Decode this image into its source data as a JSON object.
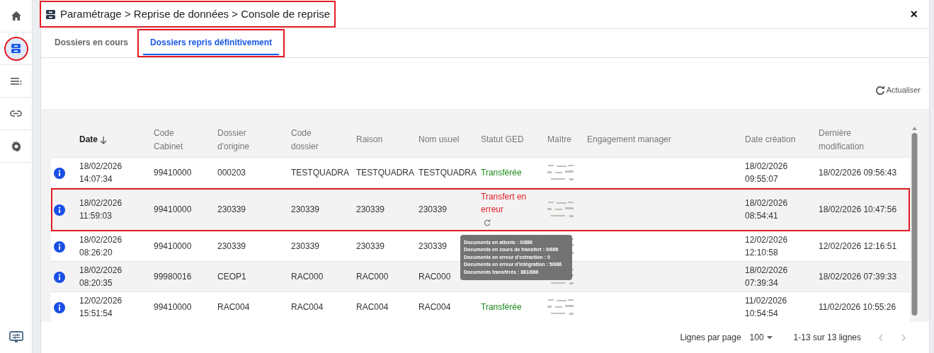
{
  "sidebar": {
    "items": [
      {
        "kind": "home",
        "selected": false,
        "highlighted": false
      },
      {
        "kind": "inbox",
        "selected": true,
        "highlighted": true
      },
      {
        "kind": "list",
        "selected": false,
        "highlighted": false
      },
      {
        "kind": "link",
        "selected": false,
        "highlighted": false
      },
      {
        "kind": "settings",
        "selected": false,
        "highlighted": false
      }
    ],
    "bottom_item": {
      "kind": "monitor",
      "selected": false
    }
  },
  "header": {
    "breadcrumb": "Paramétrage > Reprise de données > Console de reprise",
    "highlighted": true,
    "close": "×"
  },
  "tabs": [
    {
      "label": "Dossiers en cours",
      "selected": false,
      "highlighted": false
    },
    {
      "label": "Dossiers repris définitivement",
      "selected": true,
      "highlighted": true
    }
  ],
  "refresh": {
    "label": "Actualiser"
  },
  "table": {
    "columns": [
      {
        "label": "Date",
        "sorted": true
      },
      {
        "label": "Code Cabinet",
        "sorted": false
      },
      {
        "label": "Dossier d'origine",
        "sorted": false
      },
      {
        "label": "Code dossier",
        "sorted": false
      },
      {
        "label": "Raison",
        "sorted": false
      },
      {
        "label": "Nom usuel",
        "sorted": false
      },
      {
        "label": "Statut GED",
        "sorted": false
      },
      {
        "label": "Maître",
        "sorted": false
      },
      {
        "label": "Engagement manager",
        "sorted": false
      },
      {
        "label": "Date création",
        "sorted": false
      },
      {
        "label": "Dernière modification",
        "sorted": false
      }
    ],
    "rows": [
      {
        "date": "18/02/2026 14:07:34",
        "code_cabinet": "99410000",
        "dossier_origine": "000203",
        "code_dossier": "TESTQUADRA",
        "raison": "TESTQUADRA",
        "nom_usuel": "TESTQUADRA",
        "statut": "Transférée",
        "color": "#1d8a1d",
        "retry": false,
        "date_creation": "18/02/2026 09:55:07",
        "derniere_modification": "18/02/2026 09:56:43",
        "highlighted": false
      },
      {
        "date": "18/02/2026 11:59:03",
        "code_cabinet": "99410000",
        "dossier_origine": "230339",
        "code_dossier": "230339",
        "raison": "230339",
        "nom_usuel": "230339",
        "statut": "Transfert en erreur",
        "color": "#e3202a",
        "retry": true,
        "date_creation": "18/02/2026 08:54:41",
        "derniere_modification": "18/02/2026 10:47:56",
        "highlighted": true
      },
      {
        "date": "18/02/2026 08:26:20",
        "code_cabinet": "99410000",
        "dossier_origine": "230339",
        "code_dossier": "230339",
        "raison": "230339",
        "nom_usuel": "230339",
        "date_creation": "12/02/2026 12:10:58",
        "derniere_modification": "12/02/2026 12:16:51",
        "highlighted": false
      },
      {
        "date": "18/02/2026 08:20:35",
        "code_cabinet": "99980016",
        "dossier_origine": "CEOP1",
        "code_dossier": "RAC000",
        "raison": "RAC000",
        "nom_usuel": "RAC000",
        "date_creation": "18/02/2026 07:39:34",
        "derniere_modification": "18/02/2026 07:39:33",
        "highlighted": false
      },
      {
        "date": "12/02/2026 15:51:54",
        "code_cabinet": "99410000",
        "dossier_origine": "RAC004",
        "code_dossier": "RAC004",
        "raison": "RAC004",
        "nom_usuel": "RAC004",
        "statut": "Transférée",
        "color": "#1d8a1d",
        "retry": false,
        "date_creation": "11/02/2026 10:54:54",
        "derniere_modification": "11/02/2026 10:55:26",
        "highlighted": false
      }
    ]
  },
  "tooltip": {
    "lines": [
      "Documents en attente : 0/886",
      "Documents en cours de transfert : 0/886",
      "Documents en erreur d'extraction : 0",
      "Documents en erreur d'intégration : 5/886",
      "Documents transférés : 881/886"
    ]
  },
  "pagination": {
    "rows_per_page_label": "Lignes par page",
    "rows_per_page": "100",
    "range": "1-13 sur 13 lignes",
    "prev_disabled": true,
    "next_disabled": true
  }
}
